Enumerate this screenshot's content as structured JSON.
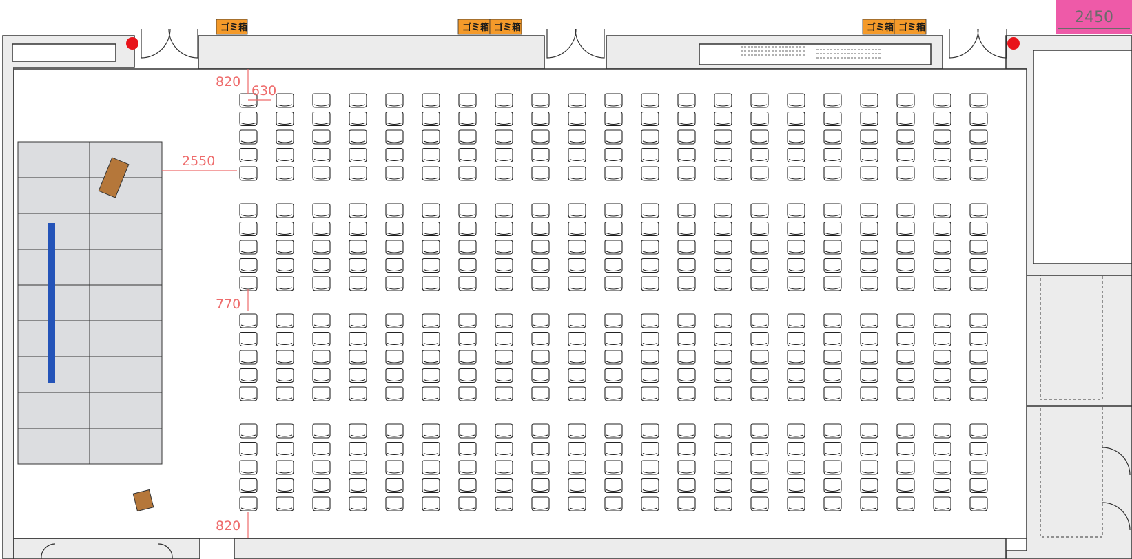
{
  "colors": {
    "wall_fill": "#ececec",
    "wall_stroke": "#333333",
    "stage_fill": "#dcdde0",
    "dimension": "#ee6b6b",
    "trash_bin": "#f49a2a",
    "fire_alarm": "#e8141b",
    "lectern": "#b5773a",
    "banner": "#2453b8",
    "badge": "#ee5aa8"
  },
  "seating": {
    "columns": 21,
    "blocks": 4,
    "rows_per_block": 5,
    "chair_icon": "chair-icon"
  },
  "trash_bins": [
    {
      "label": "ゴミ箱"
    },
    {
      "label": "ゴミ箱"
    },
    {
      "label": "ゴミ箱"
    },
    {
      "label": "ゴミ箱"
    },
    {
      "label": "ゴミ箱"
    }
  ],
  "dimensions": {
    "front_gap": "820",
    "seat_pitch": "630",
    "stage_gap": "2550",
    "aisle": "770",
    "rear_gap": "820",
    "right_width": "2450"
  },
  "icons": {
    "fire_alarm": "red-dot-icon",
    "door": "door-swing-icon"
  }
}
